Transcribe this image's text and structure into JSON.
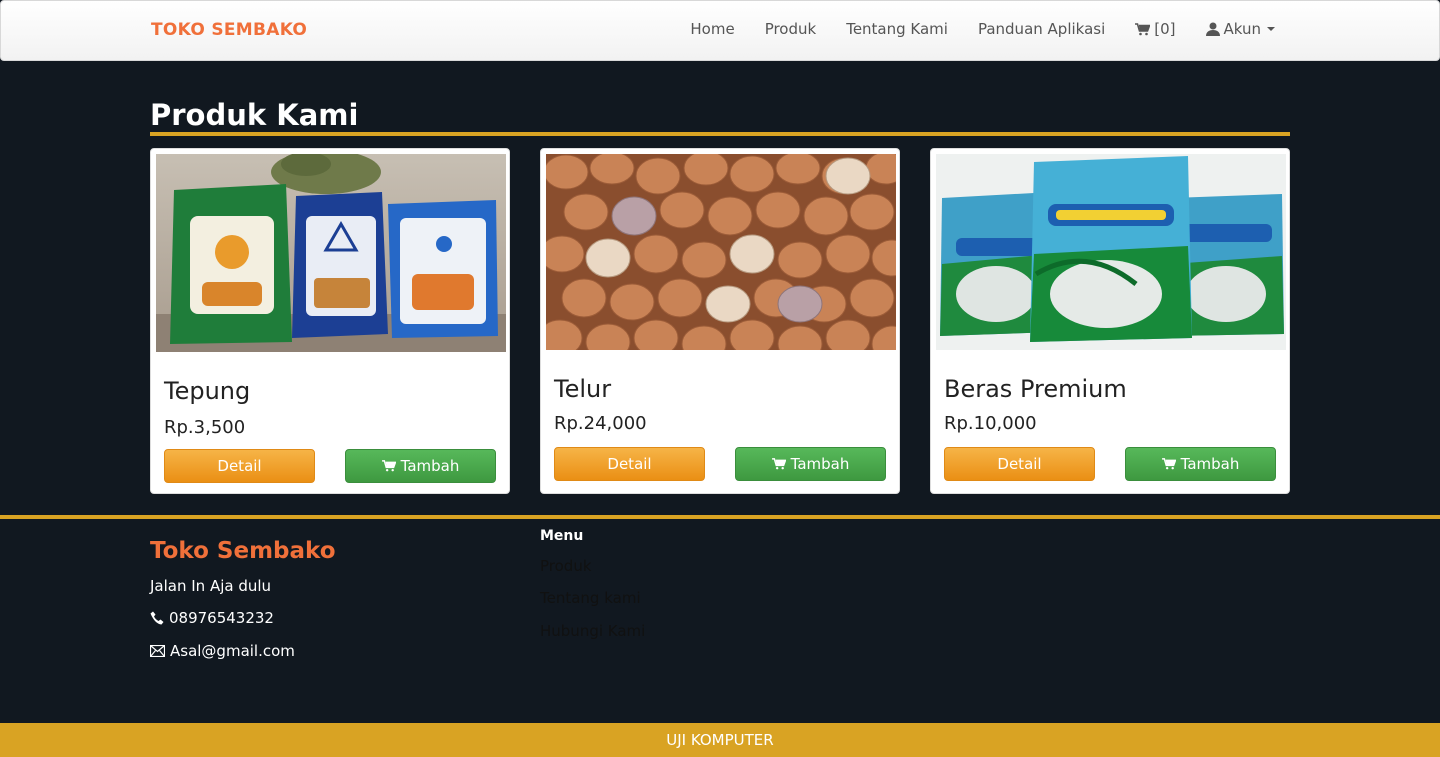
{
  "navbar": {
    "brand": "TOKO SEMBAKO",
    "links": [
      "Home",
      "Produk",
      "Tentang Kami",
      "Panduan Aplikasi"
    ],
    "cart_label": "[0]",
    "account_label": "Akun"
  },
  "main": {
    "title": "Produk Kami",
    "products": [
      {
        "name": "Tepung",
        "price": "Rp.3,500",
        "detail_label": "Detail",
        "add_label": "Tambah"
      },
      {
        "name": "Telur",
        "price": "Rp.24,000",
        "detail_label": "Detail",
        "add_label": "Tambah"
      },
      {
        "name": "Beras Premium",
        "price": "Rp.10,000",
        "detail_label": "Detail",
        "add_label": "Tambah"
      }
    ]
  },
  "footer": {
    "brand": "Toko Sembako",
    "address": "Jalan In Aja dulu",
    "phone": "08976543232",
    "email": "Asal@gmail.com",
    "menu_title": "Menu",
    "menu_items": [
      "Produk",
      "Tentang kami",
      "Hubungi Kami"
    ],
    "bottom_text": "UJI KOMPUTER"
  },
  "colors": {
    "brand": "#f0703a",
    "accent": "#d9a323",
    "background": "#111820",
    "detail_button": "#ea8f14",
    "add_button": "#3e9940"
  },
  "icons": [
    "cart-icon",
    "user-icon",
    "phone-icon",
    "envelope-icon"
  ]
}
